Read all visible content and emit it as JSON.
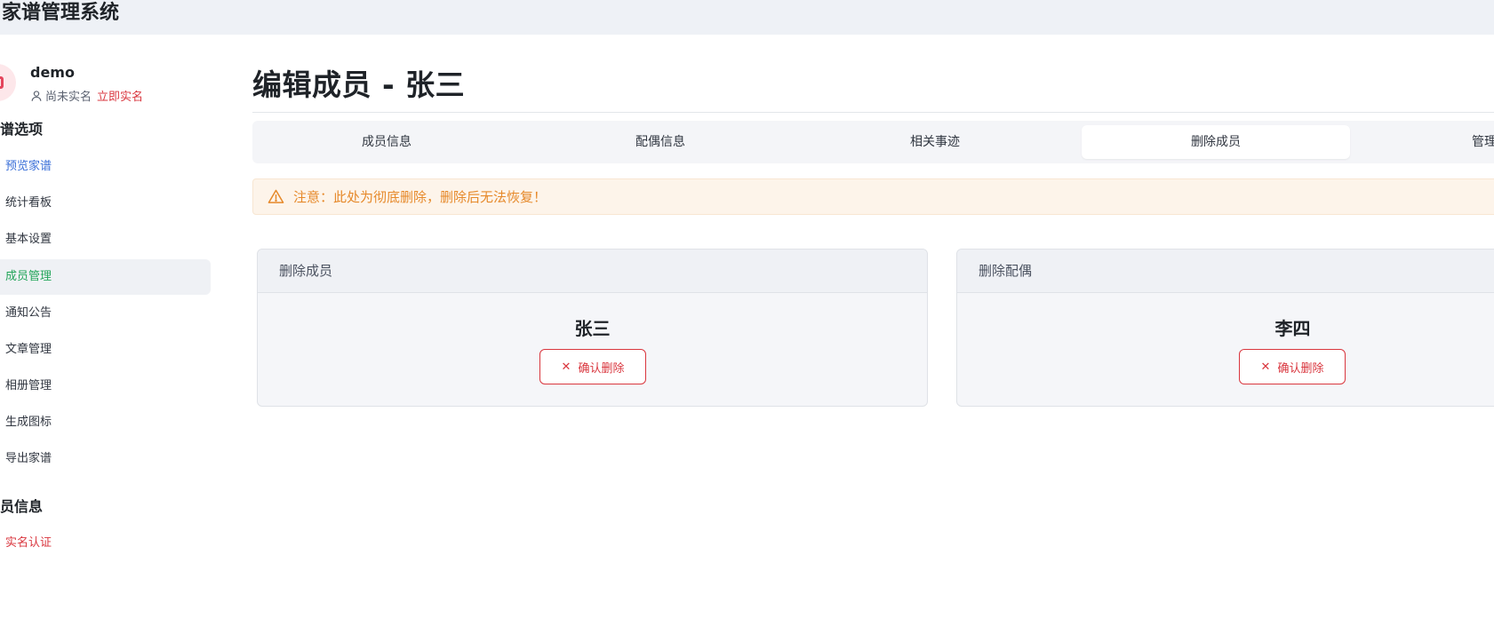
{
  "app": {
    "title": "家谱管理系统"
  },
  "user": {
    "name": "demo",
    "status": "尚未实名",
    "verify_link": "立即实名"
  },
  "sidebar": {
    "sections": [
      {
        "title": "谱选项"
      },
      {
        "title": "员信息"
      }
    ],
    "items": [
      {
        "label": "预览家谱",
        "style": "link"
      },
      {
        "label": "统计看板"
      },
      {
        "label": "基本设置"
      },
      {
        "label": "成员管理",
        "active": true
      },
      {
        "label": "通知公告"
      },
      {
        "label": "文章管理"
      },
      {
        "label": "相册管理"
      },
      {
        "label": "生成图标"
      },
      {
        "label": "导出家谱"
      },
      {
        "label": "实名认证",
        "style": "danger"
      }
    ]
  },
  "main": {
    "title": "编辑成员 - 张三",
    "tabs": [
      {
        "label": "成员信息"
      },
      {
        "label": "配偶信息"
      },
      {
        "label": "相关事迹"
      },
      {
        "label": "删除成员",
        "active": true
      },
      {
        "label": "管理"
      }
    ],
    "alert": {
      "text": "注意：此处为彻底删除，删除后无法恢复！",
      "color": "#e6892a"
    },
    "cards": [
      {
        "header": "删除成员",
        "name": "张三",
        "button": "确认删除"
      },
      {
        "header": "删除配偶",
        "name": "李四",
        "button": "确认删除"
      }
    ]
  },
  "colors": {
    "accent_active": "#23a55a",
    "danger": "#d9363e",
    "link": "#3a6fd8",
    "warning": "#e6892a"
  }
}
